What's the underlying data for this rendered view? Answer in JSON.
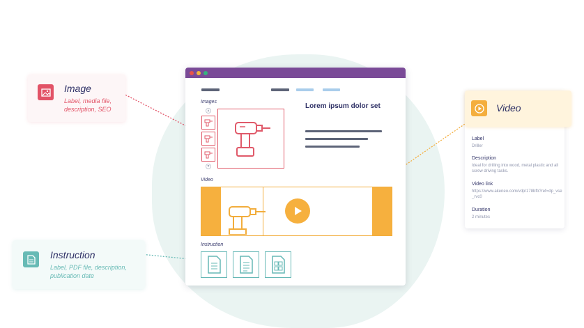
{
  "cards": {
    "image": {
      "title": "Image",
      "subtitle_line1": "Label, media file,",
      "subtitle_line2": "description, SEO",
      "icon": "image-icon",
      "accent": "#e25367"
    },
    "instruction": {
      "title": "Instruction",
      "subtitle_line1": "Label, PDF file, description,",
      "subtitle_line2": "publication date",
      "icon": "document-icon",
      "accent": "#67bab5"
    },
    "video": {
      "title": "Video",
      "icon": "play-icon",
      "accent": "#f4ae3d",
      "props": [
        {
          "label": "Label",
          "value": "Driller"
        },
        {
          "label": "Description",
          "value": "Ideal for drilling into wood, metal plastic and all screw driving tasks."
        },
        {
          "label": "Video link",
          "value": "https://www.akeneo.com/vdp/178bfb?ref=dp_vse_rvc0"
        },
        {
          "label": "Duration",
          "value": "2 minutes"
        }
      ]
    }
  },
  "browser": {
    "title_bar_color": "#7a4a97",
    "images_label": "Images",
    "video_label": "Video",
    "instruction_label": "Instruction",
    "product_title": "Lorem ipsum dolor set",
    "icons": [
      "drill-icon",
      "pdf-document-icon",
      "text-document-icon",
      "grid-document-icon",
      "play-icon"
    ]
  }
}
